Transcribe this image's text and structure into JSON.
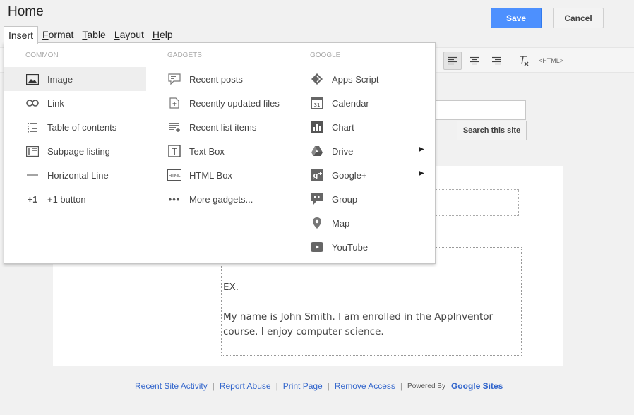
{
  "page": {
    "title": "Home"
  },
  "header": {
    "save_label": "Save",
    "cancel_label": "Cancel"
  },
  "menubar": {
    "items": [
      {
        "label": "Insert",
        "accel": "I",
        "rest": "nsert"
      },
      {
        "label": "Format",
        "accel": "F",
        "rest": "ormat"
      },
      {
        "label": "Table",
        "accel": "T",
        "rest": "able"
      },
      {
        "label": "Layout",
        "accel": "L",
        "rest": "ayout"
      },
      {
        "label": "Help",
        "accel": "H",
        "rest": "elp"
      }
    ]
  },
  "toolbar": {
    "html_label": "<HTML>"
  },
  "search": {
    "button_label": "Search this site"
  },
  "insert_menu": {
    "common": {
      "header": "Common",
      "items": [
        "Image",
        "Link",
        "Table of contents",
        "Subpage listing",
        "Horizontal Line",
        "+1 button"
      ]
    },
    "gadgets": {
      "header": "Gadgets",
      "items": [
        "Recent posts",
        "Recently updated files",
        "Recent list items",
        "Text Box",
        "HTML Box",
        "More gadgets..."
      ]
    },
    "google": {
      "header": "Google",
      "items": [
        "Apps Script",
        "Calendar",
        "Chart",
        "Drive",
        "Google+",
        "Group",
        "Map",
        "YouTube"
      ]
    }
  },
  "body": {
    "line1": "EX.",
    "line2": "My name is John Smith. I am enrolled in the AppInventor course.  I enjoy computer science."
  },
  "footer": {
    "links": [
      "Recent Site Activity",
      "Report Abuse",
      "Print Page",
      "Remove Access"
    ],
    "powered_by": "Powered By",
    "brand": "Google Sites"
  }
}
